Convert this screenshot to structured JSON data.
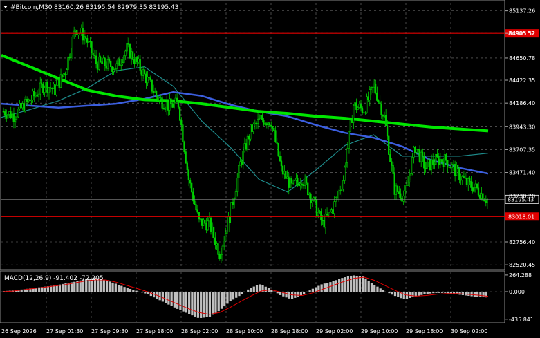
{
  "header": {
    "symbol": "#Bitcoin,M30",
    "ohlc": "83160.26 83195.54 82979.35 83195.43",
    "menu_arrow_icon": "triangle-down-icon"
  },
  "colors": {
    "background": "#000000",
    "grid": "#7a7a7a",
    "candle": "#00d000",
    "ma_slow": "#00e600",
    "ma_mid": "#3c5fe0",
    "ma_fast": "#1e8c8c",
    "level_line": "#e00000",
    "macd_hist": "#c0c0c0",
    "macd_signal": "#e00000",
    "text": "#ffffff",
    "current_price_box": "#000000"
  },
  "chart_data": [
    {
      "type": "candlestick",
      "symbol": "#Bitcoin",
      "timeframe": "M30",
      "y_ticks": [
        85137.26,
        84905.52,
        84650.78,
        84422.35,
        84186.4,
        83943.3,
        83707.35,
        83471.4,
        83230.2,
        82756.4,
        82520.45
      ],
      "ylim": [
        82500,
        85220
      ],
      "x_ticks": [
        "26 Sep 2026",
        "27 Sep 01:30",
        "27 Sep 09:30",
        "27 Sep 18:00",
        "28 Sep 02:00",
        "28 Sep 10:00",
        "28 Sep 18:00",
        "29 Sep 02:00",
        "29 Sep 10:00",
        "29 Sep 18:00",
        "30 Sep 02:00"
      ],
      "levels": [
        84905.52,
        83018.01
      ],
      "current_price": 83195.43,
      "close_path": [
        84100,
        84060,
        84160,
        84260,
        84380,
        84320,
        84520,
        84960,
        84860,
        84600,
        84580,
        84560,
        84750,
        84600,
        84420,
        84240,
        84160,
        84180,
        83400,
        82960,
        82940,
        82640,
        83020,
        83560,
        83900,
        84020,
        84000,
        83500,
        83320,
        83420,
        83200,
        82940,
        83100,
        83400,
        84160,
        84120,
        84360,
        84040,
        83300,
        83220,
        83740,
        83520,
        83600,
        83600,
        83480,
        83360,
        83300,
        83190
      ],
      "ma_slow": [
        84680,
        84560,
        84440,
        84320,
        84260,
        84220,
        84210,
        84180,
        84140,
        84100,
        84080,
        84050,
        84030,
        84000,
        83970,
        83940,
        83920,
        83900
      ],
      "ma_mid": [
        84180,
        84160,
        84140,
        84160,
        84180,
        84230,
        84300,
        84260,
        84170,
        84100,
        84050,
        83960,
        83880,
        83830,
        83740,
        83600,
        83520,
        83460
      ],
      "ma_fast": [
        84040,
        84120,
        84210,
        84340,
        84520,
        84560,
        84360,
        84000,
        83730,
        83400,
        83270,
        83500,
        83750,
        83860,
        83640,
        83640,
        83640,
        83670
      ]
    },
    {
      "type": "bar",
      "title": "MACD(12,26,9) -91.402 -72.205",
      "y_ticks": [
        264.288,
        0.0,
        -435.841
      ],
      "ylim": [
        -460,
        285
      ],
      "histogram": [
        10,
        20,
        40,
        60,
        80,
        100,
        130,
        160,
        200,
        220,
        180,
        120,
        60,
        10,
        -40,
        -120,
        -200,
        -280,
        -350,
        -420,
        -400,
        -300,
        -160,
        -60,
        60,
        120,
        40,
        -60,
        -120,
        -60,
        40,
        120,
        160,
        220,
        260,
        240,
        120,
        20,
        -60,
        -120,
        -80,
        -40,
        -20,
        -20,
        -40,
        -60,
        -80,
        -90
      ],
      "signal": [
        0,
        10,
        30,
        50,
        70,
        90,
        110,
        140,
        170,
        190,
        185,
        150,
        100,
        50,
        0,
        -60,
        -130,
        -200,
        -270,
        -330,
        -360,
        -330,
        -250,
        -160,
        -70,
        10,
        30,
        -10,
        -50,
        -60,
        -20,
        40,
        100,
        160,
        210,
        230,
        180,
        100,
        20,
        -50,
        -70,
        -60,
        -40,
        -30,
        -30,
        -40,
        -55,
        -72
      ]
    }
  ]
}
